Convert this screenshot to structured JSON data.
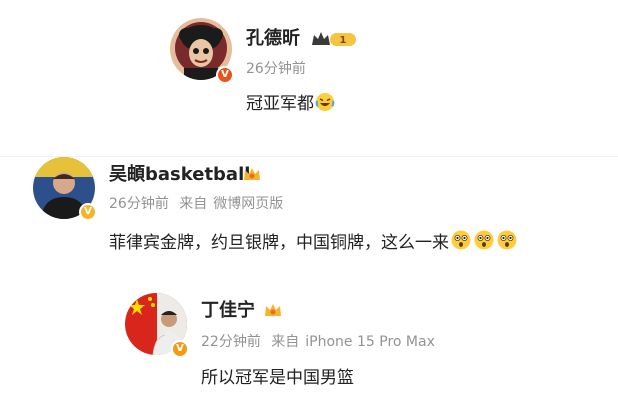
{
  "comments": [
    {
      "user": "孔德昕",
      "time": "26分钟前",
      "source_prefix": "",
      "source": "",
      "text": "冠亚军都",
      "level": "1",
      "avatar_icon": "cartoon-avatar",
      "verify_icon": "orange-v-badge"
    },
    {
      "user": "吴頔basketball",
      "time": "26分钟前",
      "source_prefix": "来自",
      "source": "微博网页版",
      "text": "菲律宾金牌，约旦银牌，中国铜牌，这么一来",
      "avatar_icon": "person-photo-avatar",
      "verify_icon": "gold-v-badge"
    },
    {
      "user": "丁佳宁",
      "time": "22分钟前",
      "source_prefix": "来自",
      "source": "iPhone 15 Pro Max",
      "text": "所以冠军是中国男篮",
      "avatar_icon": "flag-person-avatar",
      "verify_icon": "orange-v-badge"
    }
  ],
  "colors": {
    "meta": "#939393",
    "badge_orange": "#f39a12",
    "crown_gold": "#f5b52a"
  }
}
